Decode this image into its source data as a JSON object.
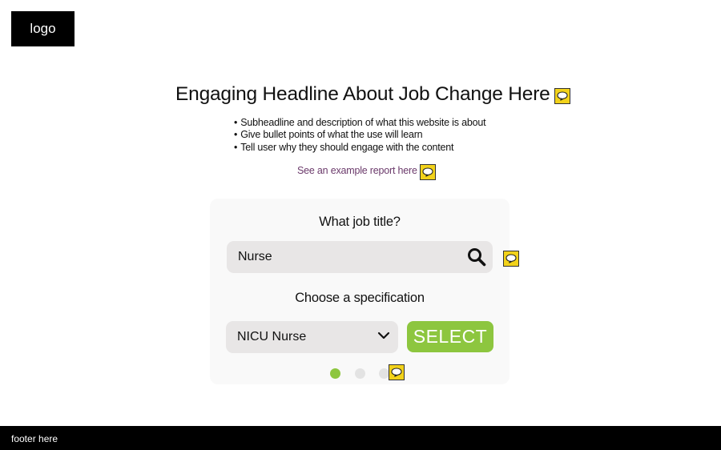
{
  "header": {
    "logo_text": "logo"
  },
  "hero": {
    "headline": "Engaging Headline About Job Change Here",
    "bullets": [
      "Subheadline and description of what this website is about",
      "Give bullet points of what the use will learn",
      "Tell user why they should engage with the content"
    ],
    "example_link": "See an example report here >"
  },
  "form": {
    "job_title_label": "What job title?",
    "job_title_value": "Nurse",
    "spec_label": "Choose a specification",
    "spec_value": "NICU Nurse",
    "select_button": "SELECT",
    "pager": {
      "total": 3,
      "current": 1
    }
  },
  "footer": {
    "text": "footer here"
  },
  "icons": {
    "comment": "comment-icon",
    "search": "search-icon",
    "chevron": "chevron-down-icon"
  },
  "colors": {
    "accent_green": "#8dc63f",
    "comment_yellow": "#f2d21a",
    "link_purple": "#6b3a6b"
  }
}
